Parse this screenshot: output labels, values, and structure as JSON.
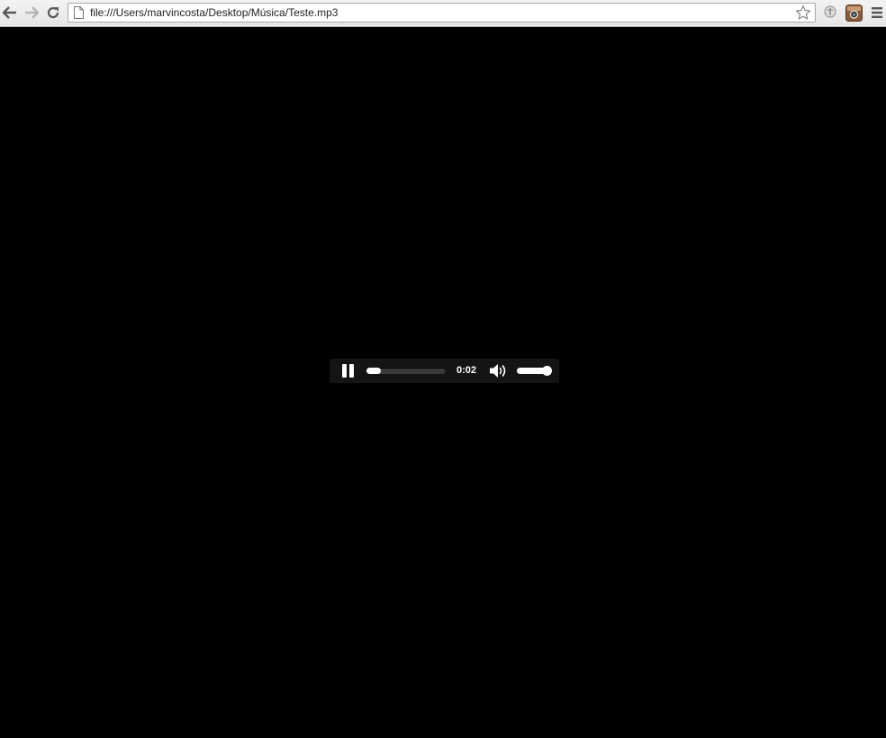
{
  "browser": {
    "url": "file:///Users/marvincosta/Desktop/Música/Teste.mp3",
    "icons": {
      "back": "arrow-left-icon",
      "forward": "arrow-right-icon",
      "reload": "reload-icon",
      "page": "page-icon",
      "bookmark": "star-icon",
      "extension1": "extension-icon",
      "extension2": "instagram-icon",
      "menu": "menu-icon"
    }
  },
  "player": {
    "state": "playing",
    "pause_icon": "pause-icon",
    "current_time": "0:02",
    "progress": 0.06,
    "volume_icon": "speaker-icon",
    "volume": 1.0
  },
  "colors": {
    "background": "#000000",
    "player_bg": "#141414",
    "toolbar_bg": "#eeeeee"
  }
}
